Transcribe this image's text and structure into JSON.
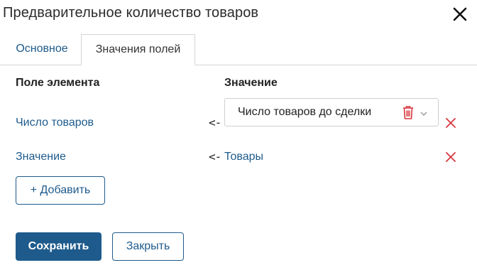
{
  "dialog": {
    "title": "Предварительное количество товаров",
    "close_icon": "close-icon"
  },
  "tabs": [
    {
      "label": "Основное",
      "active": false
    },
    {
      "label": "Значения полей",
      "active": true
    }
  ],
  "table": {
    "headers": {
      "field": "Поле элемента",
      "value": "Значение"
    },
    "rows": [
      {
        "field": "Число товаров",
        "arrow": "<-",
        "value": "Число товаров до сделки",
        "value_type": "select",
        "icons": [
          "trash-icon",
          "chevron-down-icon"
        ],
        "delete_icon": "delete-icon"
      },
      {
        "field": "Значение",
        "arrow": "<-",
        "value": "Товары",
        "value_type": "link",
        "delete_icon": "delete-icon"
      }
    ]
  },
  "buttons": {
    "add": "+ Добавить",
    "save": "Сохранить",
    "close": "Закрыть"
  },
  "colors": {
    "accent": "#1e5b8c",
    "danger": "#d9363e",
    "border": "#d4d4d4"
  }
}
